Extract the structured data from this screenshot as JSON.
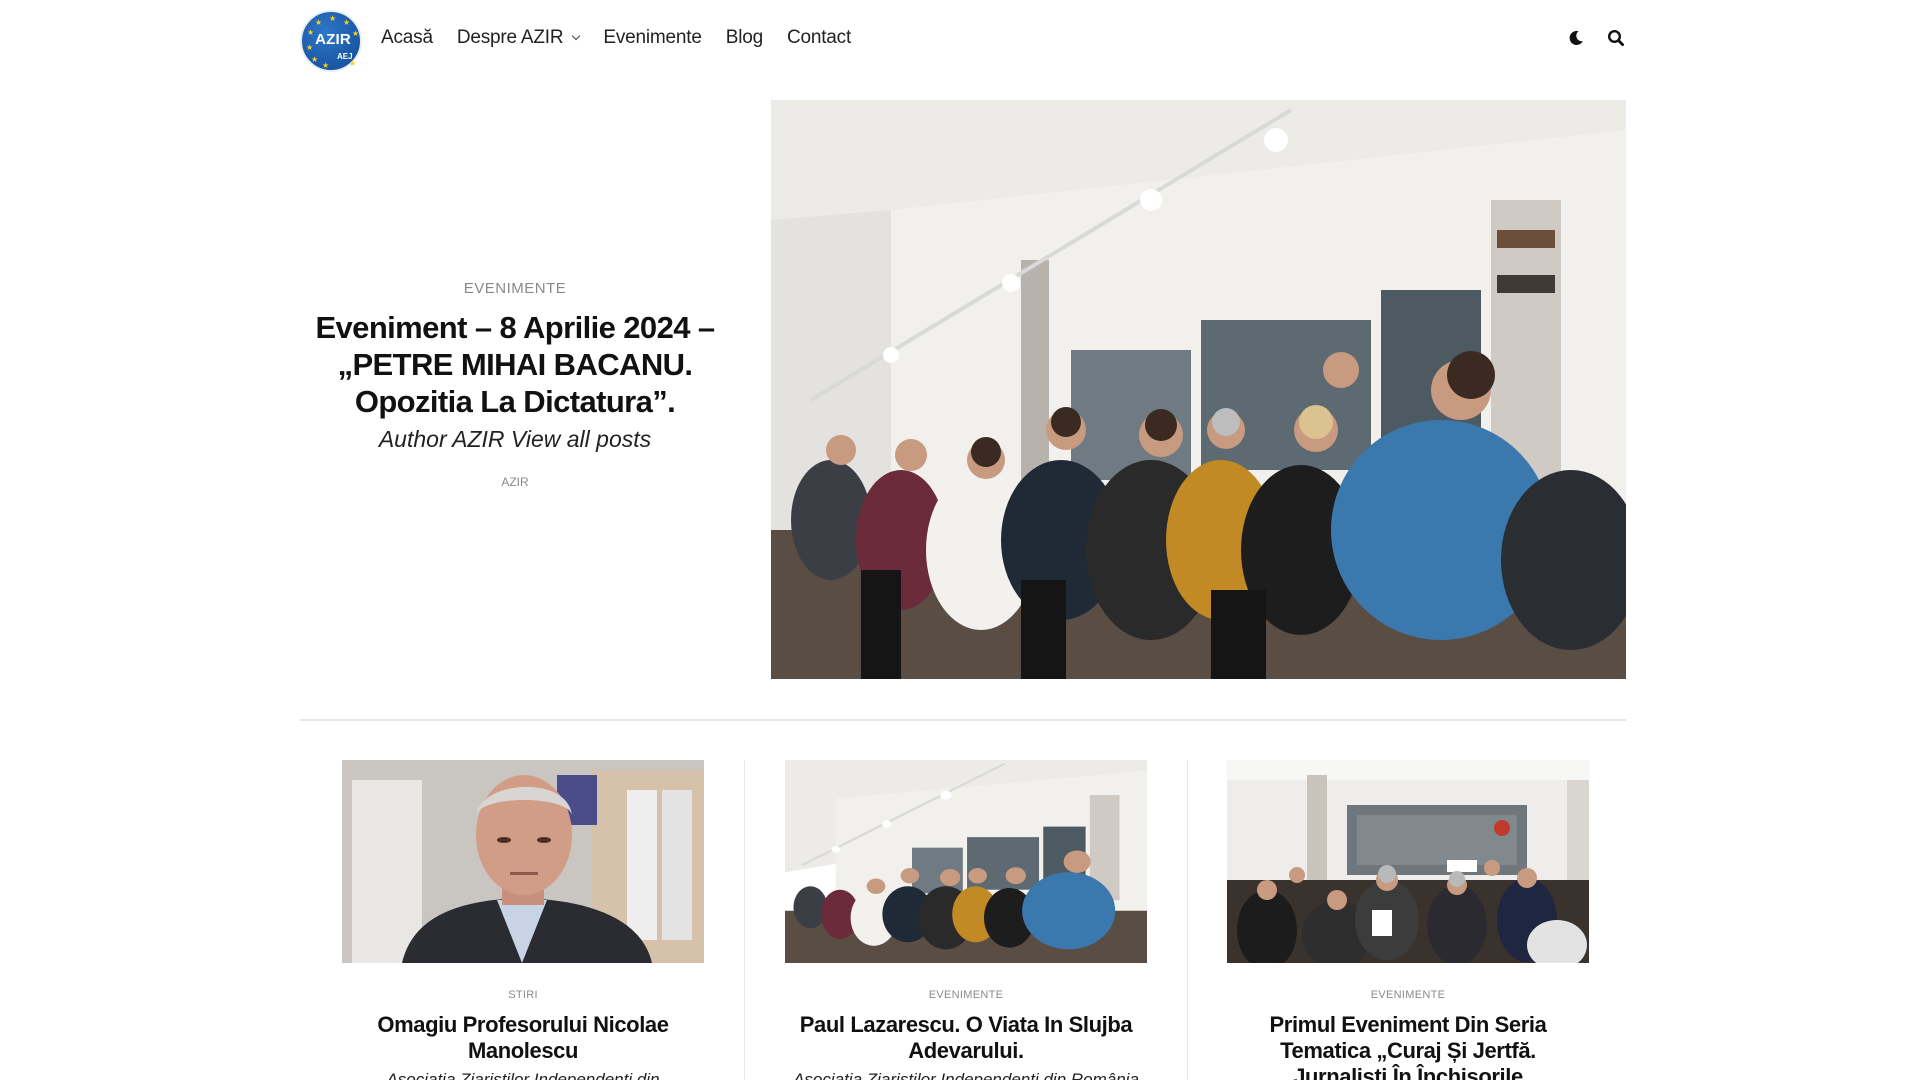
{
  "site": {
    "logo_text": "AZIR",
    "logo_subtext": "AEJ"
  },
  "nav": {
    "items": [
      {
        "label": "Acasă",
        "has_dropdown": false
      },
      {
        "label": "Despre AZIR",
        "has_dropdown": true
      },
      {
        "label": "Evenimente",
        "has_dropdown": false
      },
      {
        "label": "Blog",
        "has_dropdown": false
      },
      {
        "label": "Contact",
        "has_dropdown": false
      }
    ],
    "icons": [
      "moon-icon",
      "search-icon"
    ]
  },
  "featured": {
    "category": "Evenimente",
    "title": "Eveniment – 8 Aprilie 2024 – „PETRE MIHAI BACANU. Opozitia La Dictatura”.",
    "excerpt": "Author AZIR View all posts",
    "author": "AZIR"
  },
  "cards": [
    {
      "category": "Stiri",
      "title": "Omagiu Profesorului Nicolae Manolescu",
      "excerpt": "Asociatia Ziaristilor Independenti din"
    },
    {
      "category": "Evenimente",
      "title": "Paul Lazarescu. O Viata In Slujba Adevarului.",
      "excerpt": "Asociatia Ziaristilor Independenti din România"
    },
    {
      "category": "Evenimente",
      "title": "Primul Eveniment Din Seria Tematica „Curaj Și Jertfă. Jurnaliști În Închisorile Comuniste” – Eveniment",
      "excerpt": ""
    }
  ],
  "colors": {
    "logo_blue": "#1a57a4",
    "logo_star": "#f6d21b",
    "meta_gray": "#8a8a8a",
    "divider": "#e6e6e6"
  }
}
